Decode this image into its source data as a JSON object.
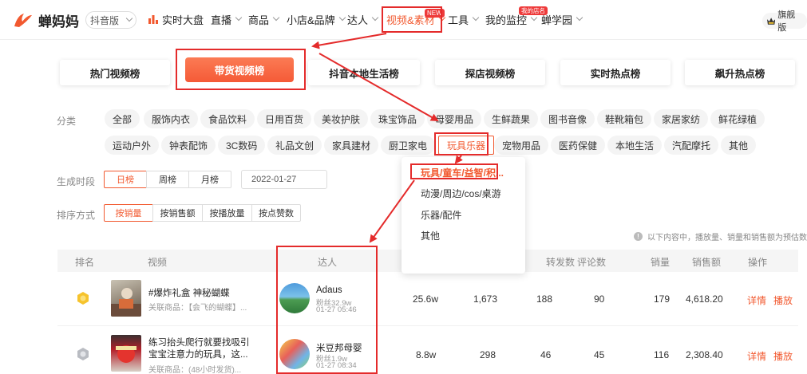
{
  "header": {
    "logo_text": "蝉妈妈",
    "version_selector": "抖音版",
    "nav": [
      {
        "label": "实时大盘",
        "has_chevron": false,
        "icon": "bar-chart-icon"
      },
      {
        "label": "直播",
        "has_chevron": true
      },
      {
        "label": "商品",
        "has_chevron": true
      },
      {
        "label": "小店&品牌",
        "has_chevron": true
      },
      {
        "label": "达人",
        "has_chevron": true
      },
      {
        "label": "视频&素材",
        "has_chevron": true,
        "badge": "NEW",
        "highlighted": true
      },
      {
        "label": "工具",
        "has_chevron": true
      },
      {
        "label": "我的监控",
        "has_chevron": true,
        "badge": "我的店名"
      },
      {
        "label": "蝉学园",
        "has_chevron": true
      }
    ],
    "flagship_label": "旗舰版"
  },
  "rank_tabs": [
    {
      "label": "热门视频榜",
      "active": false
    },
    {
      "label": "带货视频榜",
      "active": true
    },
    {
      "label": "抖音本地生活榜",
      "active": false
    },
    {
      "label": "探店视频榜",
      "active": false
    },
    {
      "label": "实时热点榜",
      "active": false
    },
    {
      "label": "飙升热点榜",
      "active": false
    }
  ],
  "filters": {
    "category_label": "分类",
    "categories_row1": [
      "全部",
      "服饰内衣",
      "食品饮料",
      "日用百货",
      "美妆护肤",
      "珠宝饰品",
      "母婴用品",
      "生鲜蔬果",
      "图书音像",
      "鞋靴箱包",
      "家居家纺",
      "鲜花绿植"
    ],
    "categories_row2": [
      "运动户外",
      "钟表配饰",
      "3C数码",
      "礼品文创",
      "家具建材",
      "厨卫家电",
      "玩具乐器",
      "宠物用品",
      "医药保健",
      "本地生活",
      "汽配摩托",
      "其他"
    ],
    "active_category": "玩具乐器",
    "period_label": "生成时段",
    "periods": [
      "日榜",
      "周榜",
      "月榜"
    ],
    "active_period": "日榜",
    "date_value": "2022-01-27",
    "sort_label": "排序方式",
    "sorts": [
      "按销量",
      "按销售额",
      "按播放量",
      "按点赞数"
    ],
    "active_sort": "按销量"
  },
  "subcategory_dropdown": [
    "玩具/童车/益智/积...",
    "动漫/周边/cos/桌游",
    "乐器/配件",
    "其他"
  ],
  "note": "以下内容中，播放量、销量和销售额为预估数",
  "table": {
    "columns": [
      "排名",
      "视频",
      "达人",
      "",
      "转发数",
      "评论数",
      "销量",
      "销售额",
      "操作"
    ],
    "rows": [
      {
        "rank_medal": "gold-medal-icon",
        "video_title": "#爆炸礼盒 神秘蝴蝶",
        "video_sub": "关联商品：【会飞的蝴蝶】...",
        "author_name": "Adaus",
        "author_fans": "粉丝32.9w",
        "author_time": "01-27 05:46",
        "plays": "25.6w",
        "likes": "1,673",
        "shares": "188",
        "comments": "90",
        "sales": "179",
        "revenue": "4,618.20",
        "ops": [
          "详情",
          "播放"
        ]
      },
      {
        "rank_medal": "silver-medal-icon",
        "video_title": "练习抬头爬行就要找吸引宝宝注意力的玩具，这...",
        "video_sub": "关联商品：(48小时发货)...",
        "author_name": "米豆邦母婴",
        "author_fans": "粉丝1.9w",
        "author_time": "01-27 08:34",
        "plays": "8.8w",
        "likes": "298",
        "shares": "46",
        "comments": "45",
        "sales": "116",
        "revenue": "2,308.40",
        "ops": [
          "详情",
          "播放"
        ]
      }
    ]
  },
  "colors": {
    "accent": "#f2592f",
    "annotation": "#e42b2b"
  }
}
